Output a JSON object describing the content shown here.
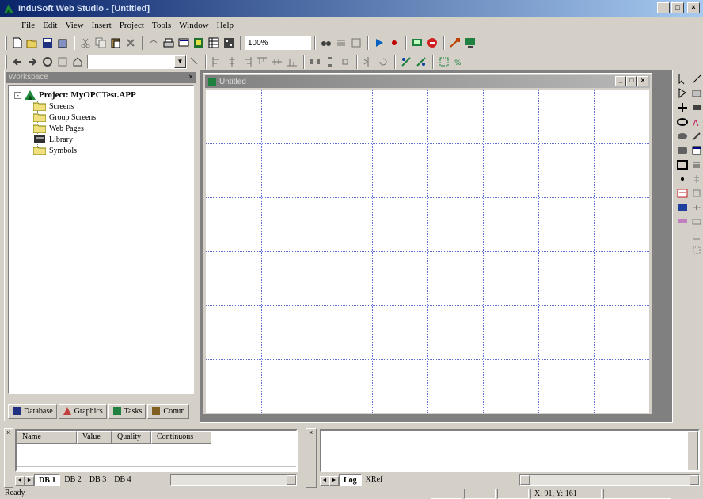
{
  "window": {
    "title": "InduSoft Web Studio - [Untitled]",
    "controls": [
      "_",
      "□",
      "×"
    ]
  },
  "menu": [
    "File",
    "Edit",
    "View",
    "Insert",
    "Project",
    "Tools",
    "Window",
    "Help"
  ],
  "toolbar1": {
    "zoom_value": "100%"
  },
  "toolbar2": {
    "address_value": ""
  },
  "workspace": {
    "title": "Workspace",
    "close": "×",
    "root_expander": "-",
    "root_label": "Project: MyOPCTest.APP",
    "items": [
      {
        "label": "Screens",
        "icon": "folder-icon"
      },
      {
        "label": "Group Screens",
        "icon": "folder-icon"
      },
      {
        "label": "Web Pages",
        "icon": "folder-icon"
      },
      {
        "label": "Library",
        "icon": "library-icon"
      },
      {
        "label": "Symbols",
        "icon": "folder-icon"
      }
    ],
    "tabs": [
      {
        "label": "Database",
        "icon": "database-icon"
      },
      {
        "label": "Graphics",
        "icon": "graphics-icon"
      },
      {
        "label": "Tasks",
        "icon": "tasks-icon"
      },
      {
        "label": "Comm",
        "icon": "comm-icon"
      }
    ]
  },
  "screen_window": {
    "title": "Untitled",
    "controls": [
      "_",
      "□",
      "×"
    ]
  },
  "watch": {
    "columns": [
      "Name",
      "Value",
      "Quality",
      "Continuous"
    ],
    "tabs": [
      "DB 1",
      "DB 2",
      "DB 3",
      "DB 4"
    ],
    "nav": [
      "◄",
      "►"
    ]
  },
  "output": {
    "tabs": [
      "Log",
      "XRef"
    ],
    "nav": [
      "◄",
      "►"
    ]
  },
  "status": {
    "text": "Ready",
    "coords": "X: 91, Y: 161"
  },
  "colors": {
    "face": "#d4d0c8",
    "titlebar_start": "#0a246a",
    "titlebar_end": "#a6caf0",
    "grid_line": "#5c6cd0"
  }
}
